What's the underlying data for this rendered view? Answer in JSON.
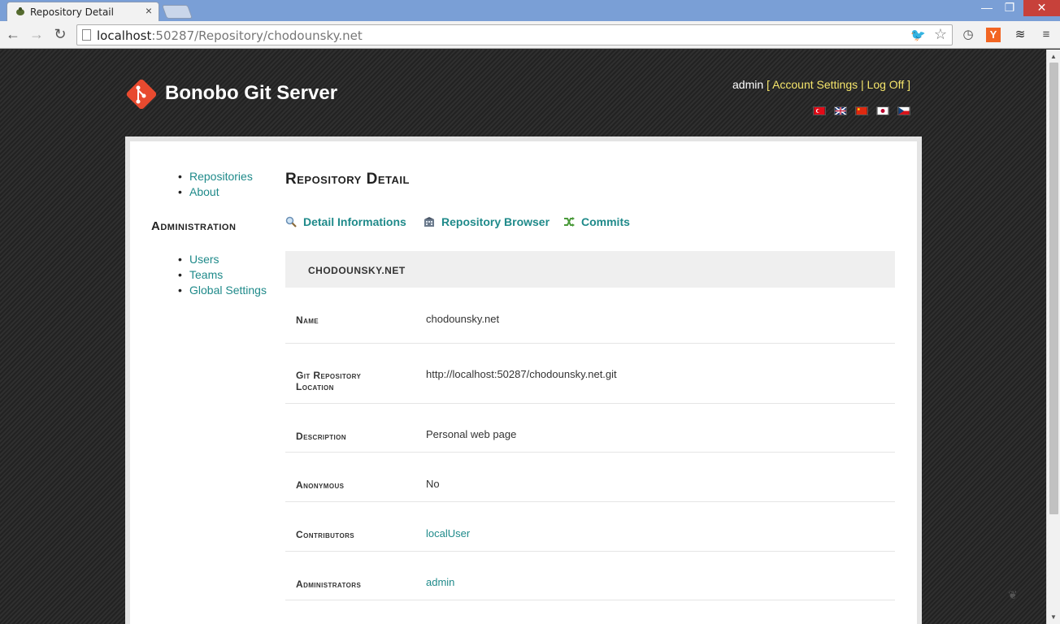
{
  "browser": {
    "tab_title": "Repository Detail",
    "tab_close": "×",
    "url_host": "localhost",
    "url_rest": ":50287/Repository/chodounsky.net",
    "win_min": "—",
    "win_max": "❐",
    "win_close": "✕",
    "nav_back": "←",
    "nav_forward": "→",
    "nav_reload": "↻",
    "star": "☆",
    "twitter_icon": "🐦",
    "ext_y_label": "Y",
    "clock_icon": "◷",
    "layers_icon": "≋",
    "menu_icon": "≡"
  },
  "header": {
    "brand": "Bonobo Git Server",
    "user": "admin",
    "bracket_open": "[",
    "account_settings": "Account Settings",
    "separator": "|",
    "log_off": "Log Off",
    "bracket_close": "]",
    "flags": [
      "tr",
      "gb",
      "cn",
      "jp",
      "cz"
    ]
  },
  "sidebar": {
    "top_items": [
      "Repositories",
      "About"
    ],
    "admin_heading": "Administration",
    "admin_items": [
      "Users",
      "Teams",
      "Global Settings"
    ]
  },
  "main": {
    "title": "Repository Detail",
    "subnav": [
      {
        "label": "Detail Informations",
        "icon": "magnifier-icon"
      },
      {
        "label": "Repository Browser",
        "icon": "building-icon"
      },
      {
        "label": "Commits",
        "icon": "shuffle-icon"
      }
    ],
    "repo_name": "CHODOUNSKY.NET",
    "details": [
      {
        "label": "Name",
        "value": "chodounsky.net"
      },
      {
        "label": "Git Repository Location",
        "value": "http://localhost:50287/chodounsky.net.git"
      },
      {
        "label": "Description",
        "value": "Personal web page"
      },
      {
        "label": "Anonymous",
        "value": "No"
      },
      {
        "label": "Contributors",
        "value": "localUser"
      },
      {
        "label": "Administrators",
        "value": "admin"
      }
    ]
  },
  "colors": {
    "link": "#1f8a8a",
    "header_link": "#f5e56b",
    "logo": "#e84a2f"
  }
}
